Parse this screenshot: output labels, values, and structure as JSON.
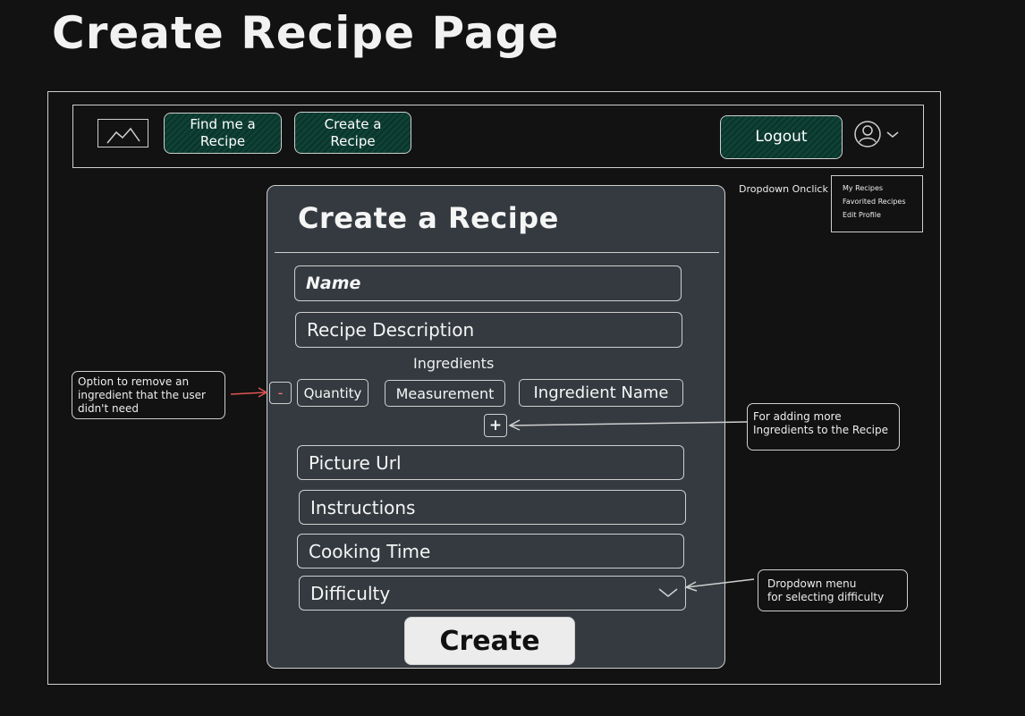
{
  "page_title": "Create Recipe Page",
  "navbar": {
    "find_label": "Find me a\nRecipe",
    "create_label": "Create a\nRecipe",
    "logout_label": "Logout"
  },
  "dropdown": {
    "note": "Dropdown Onclick",
    "items": [
      "My Recipes",
      "Favorited Recipes",
      "Edit Profile"
    ]
  },
  "form": {
    "title": "Create a Recipe",
    "name_placeholder": "Name",
    "description_placeholder": "Recipe Description",
    "ingredients_label": "Ingredients",
    "remove_label": "-",
    "quantity_placeholder": "Quantity",
    "measurement_placeholder": "Measurement",
    "ingredient_name_placeholder": "Ingredient Name",
    "add_label": "+",
    "picture_url_placeholder": "Picture Url",
    "instructions_placeholder": "Instructions",
    "cooking_time_placeholder": "Cooking Time",
    "difficulty_placeholder": "Difficulty",
    "create_label": "Create"
  },
  "annotations": {
    "remove": "Option to remove an\ningredient that the user\ndidn't need",
    "add": "For adding more\nIngredients to the Recipe",
    "difficulty": "Dropdown menu\nfor selecting difficulty"
  },
  "colors": {
    "background": "#121212",
    "card": "#343a40",
    "nav_button": "#0f3d33",
    "remove_accent": "#ff7070",
    "create_button": "#ececec"
  }
}
